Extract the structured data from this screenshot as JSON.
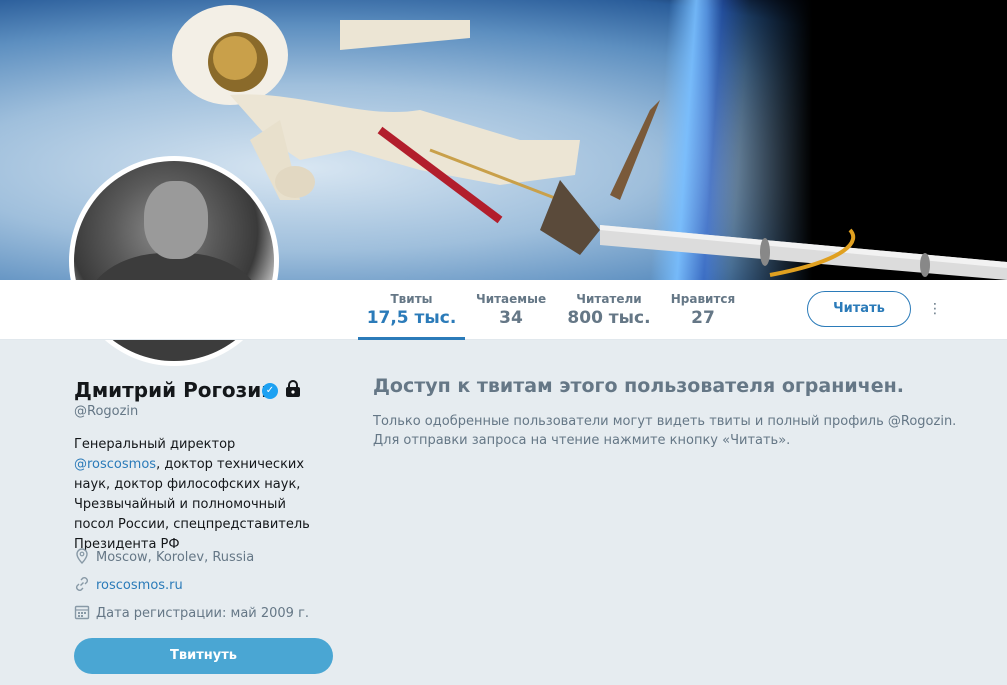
{
  "profile": {
    "name": "Дмитрий Рогозин",
    "handle": "@Rogozin",
    "bio_prefix": "Генеральный директор ",
    "bio_link": "@roscosmos",
    "bio_suffix": ", доктор технических наук, доктор философских наук, Чрезвычайный и полномочный посол России, спецпредставитель Президента РФ",
    "location": "Moscow, Korolev, Russia",
    "website": "roscosmos.ru",
    "joined": "Дата регистрации: май 2009 г.",
    "verified_icon": "verified-badge-icon",
    "verified_glyph": "✓",
    "lock_icon": "protected-lock-icon"
  },
  "stats": [
    {
      "label": "Твиты",
      "value": "17,5 тыс."
    },
    {
      "label": "Читаемые",
      "value": "34"
    },
    {
      "label": "Читатели",
      "value": "800 тыс."
    },
    {
      "label": "Нравится",
      "value": "27"
    }
  ],
  "actions": {
    "follow_label": "Читать",
    "more_glyph": "⋮",
    "tweet_label": "Твитнуть"
  },
  "main": {
    "restricted_title": "Доступ к твитам этого пользователя ограничен.",
    "restricted_text": "Только одобренные пользователи могут видеть твиты и полный профиль @Rogozin. Для отправки запроса на чтение нажмите кнопку «Читать»."
  },
  "colors": {
    "link": "#2b7bb9",
    "tweet_button": "#4aa6d3",
    "verified": "#1da1f2",
    "background": "#e6ecf0"
  }
}
